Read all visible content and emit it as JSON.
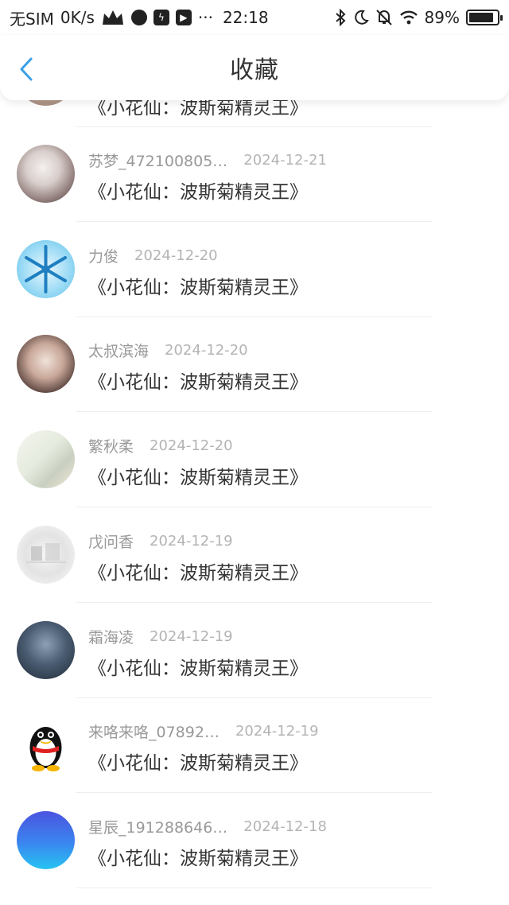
{
  "status_bar": {
    "carrier": "无SIM",
    "speed": "0K/s",
    "dots": "···",
    "time": "22:18",
    "battery_percent": "89%",
    "battery_level": 0.89
  },
  "nav": {
    "title": "收藏",
    "back_icon": "chevron-left-icon",
    "accent_color": "#3aa0e8"
  },
  "partial_top_title": "《小花仙：波斯菊精灵王》",
  "items": [
    {
      "name": "苏梦_472100805…",
      "date": "2024-12-21",
      "title": "《小花仙：波斯菊精灵王》",
      "avatar": "photo-girl-sketch"
    },
    {
      "name": "力俊",
      "date": "2024-12-20",
      "title": "《小花仙：波斯菊精灵王》",
      "avatar": "snowflake"
    },
    {
      "name": "太叔滨海",
      "date": "2024-12-20",
      "title": "《小花仙：波斯菊精灵王》",
      "avatar": "photo-girl"
    },
    {
      "name": "繁秋柔",
      "date": "2024-12-20",
      "title": "《小花仙：波斯菊精灵王》",
      "avatar": "photo-room"
    },
    {
      "name": "戊问香",
      "date": "2024-12-19",
      "title": "《小花仙：波斯菊精灵王》",
      "avatar": "faded-art"
    },
    {
      "name": "霜海凌",
      "date": "2024-12-19",
      "title": "《小花仙：波斯菊精灵王》",
      "avatar": "photo-dark"
    },
    {
      "name": "来咯来咯_07892…",
      "date": "2024-12-19",
      "title": "《小花仙：波斯菊精灵王》",
      "avatar": "qq-penguin"
    },
    {
      "name": "星辰_191288646…",
      "date": "2024-12-18",
      "title": "《小花仙：波斯菊精灵王》",
      "avatar": "blue-gradient"
    }
  ]
}
